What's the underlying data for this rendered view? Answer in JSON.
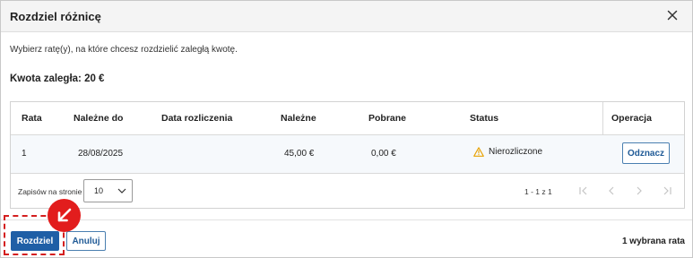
{
  "dialog": {
    "title": "Rozdziel różnicę",
    "intro": "Wybierz ratę(y), na które chcesz rozdzielić zaległą kwotę.",
    "amount_label": "Kwota zaległa: 20 €"
  },
  "table": {
    "columns": [
      "Rata",
      "Należne do",
      "Data rozliczenia",
      "Należne",
      "Pobrane",
      "Status",
      "Operacja"
    ],
    "rows": [
      {
        "rata": "1",
        "due_date": "28/08/2025",
        "settlement_date": "",
        "due_amount": "45,00 €",
        "collected": "0,00 €",
        "status": "Nierozliczone",
        "status_icon": "warning-icon",
        "action_label": "Odznacz"
      }
    ],
    "pagination": {
      "per_page_label": "Zapisów na stronie",
      "per_page_value": "10",
      "range_text": "1 - 1 z 1"
    }
  },
  "footer": {
    "primary_label": "Rozdziel",
    "cancel_label": "Anuluj",
    "selected_count": "1 wybrana rata"
  },
  "colors": {
    "primary": "#1f5fa6",
    "warning": "#e8a100",
    "highlight": "#d41f1f"
  }
}
